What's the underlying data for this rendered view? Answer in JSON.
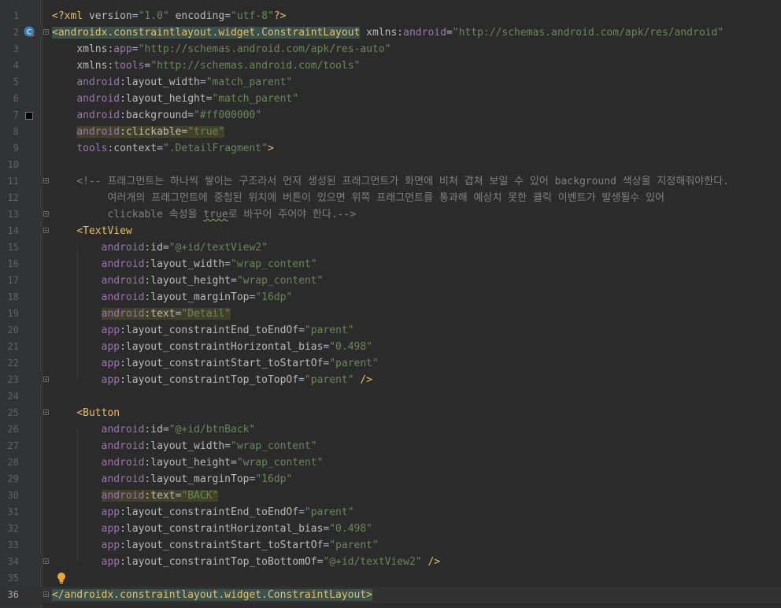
{
  "editor": {
    "language": "xml",
    "current_line": 36,
    "lines": [
      {
        "n": "1",
        "segs": [
          [
            "pi",
            "<?xml "
          ],
          [
            "attr",
            "version"
          ],
          [
            "plain",
            "="
          ],
          [
            "val",
            "\"1.0\""
          ],
          [
            "plain",
            " "
          ],
          [
            "attr",
            "encoding"
          ],
          [
            "plain",
            "="
          ],
          [
            "val",
            "\"utf-8\""
          ],
          [
            "pi",
            "?>"
          ]
        ]
      },
      {
        "n": "2",
        "segs": [
          [
            "tag-hl",
            "<androidx.constraintlayout.widget.ConstraintLayout"
          ],
          [
            "plain",
            " "
          ],
          [
            "attr",
            "xmlns:"
          ],
          [
            "ns",
            "android"
          ],
          [
            "plain",
            "="
          ],
          [
            "val",
            "\"http://schemas.android.com/apk/res/android\""
          ]
        ]
      },
      {
        "n": "3",
        "segs": [
          [
            "plain",
            "    "
          ],
          [
            "attr",
            "xmlns:"
          ],
          [
            "ns",
            "app"
          ],
          [
            "plain",
            "="
          ],
          [
            "val",
            "\"http://schemas.android.com/apk/res-auto\""
          ]
        ]
      },
      {
        "n": "4",
        "segs": [
          [
            "plain",
            "    "
          ],
          [
            "attr",
            "xmlns:"
          ],
          [
            "ns",
            "tools"
          ],
          [
            "plain",
            "="
          ],
          [
            "val",
            "\"http://schemas.android.com/tools\""
          ]
        ]
      },
      {
        "n": "5",
        "segs": [
          [
            "plain",
            "    "
          ],
          [
            "ns",
            "android"
          ],
          [
            "attr",
            ":layout_width"
          ],
          [
            "plain",
            "="
          ],
          [
            "val",
            "\"match_parent\""
          ]
        ]
      },
      {
        "n": "6",
        "segs": [
          [
            "plain",
            "    "
          ],
          [
            "ns",
            "android"
          ],
          [
            "attr",
            ":layout_height"
          ],
          [
            "plain",
            "="
          ],
          [
            "val",
            "\"match_parent\""
          ]
        ]
      },
      {
        "n": "7",
        "segs": [
          [
            "plain",
            "    "
          ],
          [
            "ns",
            "android"
          ],
          [
            "attr",
            ":background"
          ],
          [
            "plain",
            "="
          ],
          [
            "val",
            "\"#ff000000\""
          ]
        ]
      },
      {
        "n": "8",
        "segs": [
          [
            "plain",
            "    "
          ],
          [
            "ns-hl",
            "android"
          ],
          [
            "attr-hl",
            ":clickable"
          ],
          [
            "plain-hl",
            "="
          ],
          [
            "val-hl",
            "\"true\""
          ]
        ]
      },
      {
        "n": "9",
        "segs": [
          [
            "plain",
            "    "
          ],
          [
            "ns",
            "tools"
          ],
          [
            "attr",
            ":context"
          ],
          [
            "plain",
            "="
          ],
          [
            "val",
            "\".DetailFragment\""
          ],
          [
            "tag",
            ">"
          ]
        ]
      },
      {
        "n": "10",
        "segs": []
      },
      {
        "n": "11",
        "segs": [
          [
            "plain",
            "    "
          ],
          [
            "com",
            "<!-- 프래그먼트는 하나씩 쌓이는 구조라서 먼저 생성된 프래그먼트가 화면에 비쳐 겹쳐 보일 수 있어 background 색상을 지정해줘야한다."
          ]
        ]
      },
      {
        "n": "12",
        "segs": [
          [
            "com",
            "         여러개의 프래그먼트에 중첩된 위치에 버튼이 있으면 위쪽 프래그먼트를 통과해 예상치 못한 클릭 이벤트가 발생될수 있어"
          ]
        ]
      },
      {
        "n": "13",
        "segs": [
          [
            "com",
            "         clickable 속성을 "
          ],
          [
            "com-warn",
            "true"
          ],
          [
            "com",
            "로 바꾸어 주어야 한다.-->"
          ]
        ]
      },
      {
        "n": "14",
        "segs": [
          [
            "plain",
            "    "
          ],
          [
            "tag",
            "<TextView"
          ]
        ]
      },
      {
        "n": "15",
        "segs": [
          [
            "plain",
            "        "
          ],
          [
            "ns",
            "android"
          ],
          [
            "attr",
            ":id"
          ],
          [
            "plain",
            "="
          ],
          [
            "val",
            "\"@+id/textView2\""
          ]
        ]
      },
      {
        "n": "16",
        "segs": [
          [
            "plain",
            "        "
          ],
          [
            "ns",
            "android"
          ],
          [
            "attr",
            ":layout_width"
          ],
          [
            "plain",
            "="
          ],
          [
            "val",
            "\"wrap_content\""
          ]
        ]
      },
      {
        "n": "17",
        "segs": [
          [
            "plain",
            "        "
          ],
          [
            "ns",
            "android"
          ],
          [
            "attr",
            ":layout_height"
          ],
          [
            "plain",
            "="
          ],
          [
            "val",
            "\"wrap_content\""
          ]
        ]
      },
      {
        "n": "18",
        "segs": [
          [
            "plain",
            "        "
          ],
          [
            "ns",
            "android"
          ],
          [
            "attr",
            ":layout_marginTop"
          ],
          [
            "plain",
            "="
          ],
          [
            "val",
            "\"16dp\""
          ]
        ]
      },
      {
        "n": "19",
        "segs": [
          [
            "plain",
            "        "
          ],
          [
            "ns-hl",
            "android"
          ],
          [
            "attr-hl",
            ":text"
          ],
          [
            "plain-hl",
            "="
          ],
          [
            "val-hl",
            "\"Detail\""
          ]
        ]
      },
      {
        "n": "20",
        "segs": [
          [
            "plain",
            "        "
          ],
          [
            "ns",
            "app"
          ],
          [
            "attr",
            ":layout_constraintEnd_toEndOf"
          ],
          [
            "plain",
            "="
          ],
          [
            "val",
            "\"parent\""
          ]
        ]
      },
      {
        "n": "21",
        "segs": [
          [
            "plain",
            "        "
          ],
          [
            "ns",
            "app"
          ],
          [
            "attr",
            ":layout_constraintHorizontal_bias"
          ],
          [
            "plain",
            "="
          ],
          [
            "val",
            "\"0.498\""
          ]
        ]
      },
      {
        "n": "22",
        "segs": [
          [
            "plain",
            "        "
          ],
          [
            "ns",
            "app"
          ],
          [
            "attr",
            ":layout_constraintStart_toStartOf"
          ],
          [
            "plain",
            "="
          ],
          [
            "val",
            "\"parent\""
          ]
        ]
      },
      {
        "n": "23",
        "segs": [
          [
            "plain",
            "        "
          ],
          [
            "ns",
            "app"
          ],
          [
            "attr",
            ":layout_constraintTop_toTopOf"
          ],
          [
            "plain",
            "="
          ],
          [
            "val",
            "\"parent\""
          ],
          [
            "plain",
            " "
          ],
          [
            "tag",
            "/>"
          ]
        ]
      },
      {
        "n": "24",
        "segs": []
      },
      {
        "n": "25",
        "segs": [
          [
            "plain",
            "    "
          ],
          [
            "tag",
            "<Button"
          ]
        ]
      },
      {
        "n": "26",
        "segs": [
          [
            "plain",
            "        "
          ],
          [
            "ns",
            "android"
          ],
          [
            "attr",
            ":id"
          ],
          [
            "plain",
            "="
          ],
          [
            "val",
            "\"@+id/btnBack\""
          ]
        ]
      },
      {
        "n": "27",
        "segs": [
          [
            "plain",
            "        "
          ],
          [
            "ns",
            "android"
          ],
          [
            "attr",
            ":layout_width"
          ],
          [
            "plain",
            "="
          ],
          [
            "val",
            "\"wrap_content\""
          ]
        ]
      },
      {
        "n": "28",
        "segs": [
          [
            "plain",
            "        "
          ],
          [
            "ns",
            "android"
          ],
          [
            "attr",
            ":layout_height"
          ],
          [
            "plain",
            "="
          ],
          [
            "val",
            "\"wrap_content\""
          ]
        ]
      },
      {
        "n": "29",
        "segs": [
          [
            "plain",
            "        "
          ],
          [
            "ns",
            "android"
          ],
          [
            "attr",
            ":layout_marginTop"
          ],
          [
            "plain",
            "="
          ],
          [
            "val",
            "\"16dp\""
          ]
        ]
      },
      {
        "n": "30",
        "segs": [
          [
            "plain",
            "        "
          ],
          [
            "ns-hl",
            "android"
          ],
          [
            "attr-hl",
            ":text"
          ],
          [
            "plain-hl",
            "="
          ],
          [
            "val-hl",
            "\"BACK\""
          ]
        ]
      },
      {
        "n": "31",
        "segs": [
          [
            "plain",
            "        "
          ],
          [
            "ns",
            "app"
          ],
          [
            "attr",
            ":layout_constraintEnd_toEndOf"
          ],
          [
            "plain",
            "="
          ],
          [
            "val",
            "\"parent\""
          ]
        ]
      },
      {
        "n": "32",
        "segs": [
          [
            "plain",
            "        "
          ],
          [
            "ns",
            "app"
          ],
          [
            "attr",
            ":layout_constraintHorizontal_bias"
          ],
          [
            "plain",
            "="
          ],
          [
            "val",
            "\"0.498\""
          ]
        ]
      },
      {
        "n": "33",
        "segs": [
          [
            "plain",
            "        "
          ],
          [
            "ns",
            "app"
          ],
          [
            "attr",
            ":layout_constraintStart_toStartOf"
          ],
          [
            "plain",
            "="
          ],
          [
            "val",
            "\"parent\""
          ]
        ]
      },
      {
        "n": "34",
        "segs": [
          [
            "plain",
            "        "
          ],
          [
            "ns",
            "app"
          ],
          [
            "attr",
            ":layout_constraintTop_toBottomOf"
          ],
          [
            "plain",
            "="
          ],
          [
            "val",
            "\"@+id/textView2\""
          ],
          [
            "plain",
            " "
          ],
          [
            "tag",
            "/>"
          ]
        ]
      },
      {
        "n": "35",
        "segs": []
      },
      {
        "n": "36",
        "segs": [
          [
            "tag-hl",
            "</androidx.constraintlayout.widget.ConstraintLayout>"
          ]
        ]
      }
    ],
    "fold_lines": [
      "2",
      "11",
      "13",
      "14",
      "23",
      "25",
      "34",
      "36"
    ],
    "gutter_icons": {
      "class_icon_line": "2",
      "color_swatch_line": "7",
      "color_swatch": "#000000",
      "bulb_line": "35"
    }
  }
}
